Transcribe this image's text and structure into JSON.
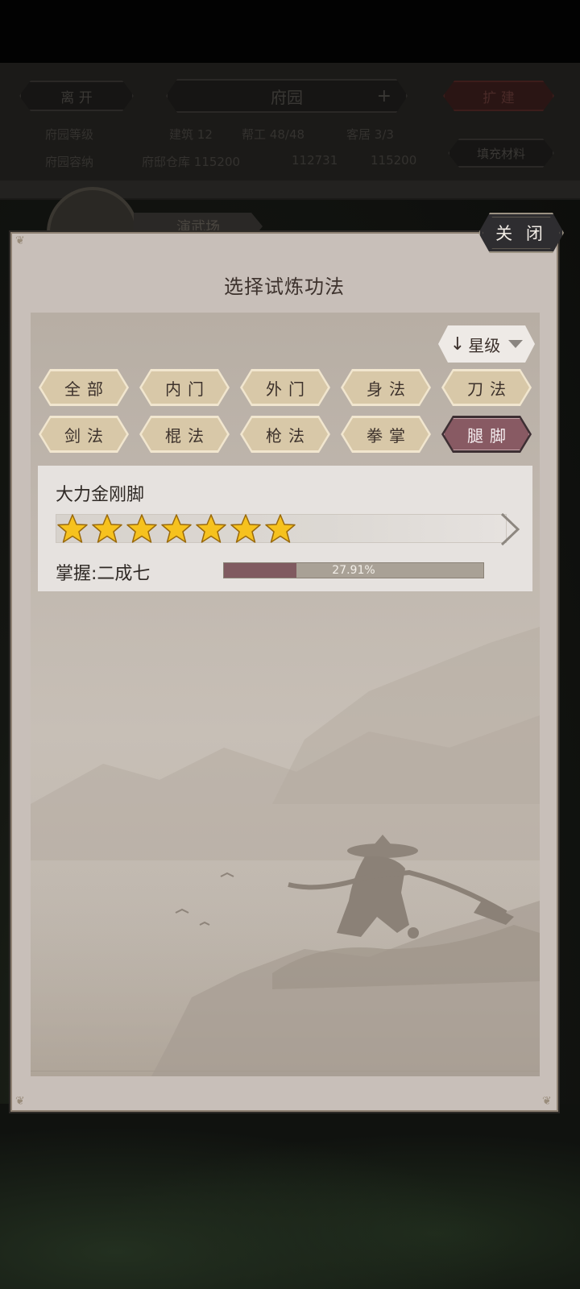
{
  "background": {
    "leave_button": "离 开",
    "location_title": "府园",
    "plus_icon": "+",
    "expand_button": "扩 建",
    "fill_materials_button": "填充材料",
    "left_info_1": "府园等级",
    "left_info_2": "府园容纳",
    "building": "建筑",
    "building_value": "12",
    "workers": "帮工",
    "workers_value": "48/48",
    "residents": "客居",
    "residents_value": "3/3",
    "storage_label": "府邸仓库",
    "storage_value_1": "115200",
    "storage_value_2": "112731",
    "storage_value_3": "115200",
    "location_tag": "演武场"
  },
  "dialog": {
    "close_button": "关 闭",
    "title": "选择试炼功法",
    "sort": {
      "arrow": "↓",
      "label": "星级"
    },
    "filter_tabs": [
      {
        "label": "全部",
        "active": false
      },
      {
        "label": "内门",
        "active": false
      },
      {
        "label": "外门",
        "active": false
      },
      {
        "label": "身法",
        "active": false
      },
      {
        "label": "刀法",
        "active": false
      },
      {
        "label": "剑法",
        "active": false
      },
      {
        "label": "棍法",
        "active": false
      },
      {
        "label": "枪法",
        "active": false
      },
      {
        "label": "拳掌",
        "active": false
      },
      {
        "label": "腿脚",
        "active": true
      }
    ],
    "technique": {
      "name": "大力金刚脚",
      "star_count": 7,
      "mastery_label": "掌握:二成七",
      "mastery_percent_text": "27.91%",
      "mastery_fraction": 0.2791
    }
  },
  "colors": {
    "active_tab": "#885a63",
    "progress_fill": "#805a60",
    "star_gold": "#f6c21e"
  },
  "icons": {
    "sort_arrow": "down-arrow-icon",
    "dropdown": "caret-down-icon",
    "stars": "star-icon",
    "chevron": "chevron-right-icon",
    "plus": "plus-icon"
  }
}
